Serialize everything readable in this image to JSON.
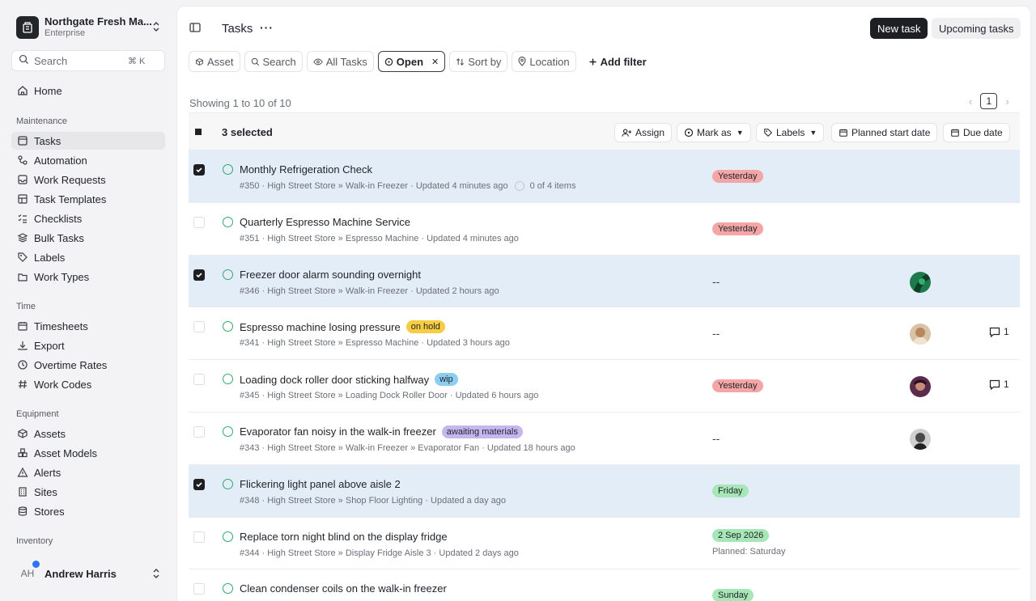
{
  "org": {
    "name": "Northgate Fresh Ma...",
    "plan": "Enterprise"
  },
  "search": {
    "placeholder": "Search",
    "shortcut": "⌘ K"
  },
  "nav": {
    "home": "Home",
    "sections": {
      "maintenance": "Maintenance",
      "time": "Time",
      "equipment": "Equipment",
      "inventory": "Inventory"
    },
    "maintenance": [
      "Tasks",
      "Automation",
      "Work Requests",
      "Task Templates",
      "Checklists",
      "Bulk Tasks",
      "Labels",
      "Work Types"
    ],
    "time": [
      "Timesheets",
      "Export",
      "Overtime Rates",
      "Work Codes"
    ],
    "equipment": [
      "Assets",
      "Asset Models",
      "Alerts",
      "Sites",
      "Stores"
    ]
  },
  "user": {
    "initials": "AH",
    "name": "Andrew Harris"
  },
  "header": {
    "title": "Tasks",
    "more": "···",
    "new_task": "New task",
    "upcoming": "Upcoming tasks"
  },
  "filters": {
    "asset": "Asset",
    "search": "Search",
    "all_tasks": "All Tasks",
    "open": "Open",
    "sort_by": "Sort by",
    "location": "Location",
    "add_filter": "Add filter"
  },
  "list": {
    "showing": "Showing 1 to 10 of 10",
    "page": "1"
  },
  "toolbar": {
    "selected": "3 selected",
    "assign": "Assign",
    "mark_as": "Mark as",
    "labels": "Labels",
    "planned_start": "Planned start date",
    "due_date": "Due date"
  },
  "colors": {
    "accent_dark": "#1d1f22",
    "selected_row": "#e3edf8",
    "status_open": "#2fa86a",
    "overdue": "#f4a6a6",
    "upcoming": "#a7e6b6"
  },
  "tasks": [
    {
      "checked": true,
      "title": "Monthly Refrigeration Check",
      "tag": "",
      "meta": "#350 · High Street Store » Walk-in Freezer · Updated 4 minutes ago",
      "items": "0 of 4 items",
      "date": "Yesterday",
      "planned": "",
      "comments": ""
    },
    {
      "checked": false,
      "title": "Quarterly Espresso Machine Service",
      "tag": "",
      "meta": "#351 · High Street Store » Espresso Machine · Updated 4 minutes ago",
      "items": "",
      "date": "Yesterday",
      "planned": "",
      "comments": ""
    },
    {
      "checked": true,
      "title": "Freezer door alarm sounding overnight",
      "tag": "",
      "meta": "#346 · High Street Store » Walk-in Freezer · Updated 2 hours ago",
      "items": "",
      "date": "--",
      "planned": "",
      "comments": ""
    },
    {
      "checked": false,
      "title": "Espresso machine losing pressure",
      "tag": "on hold",
      "meta": "#341 · High Street Store » Espresso Machine · Updated 3 hours ago",
      "items": "",
      "date": "--",
      "planned": "",
      "comments": "1"
    },
    {
      "checked": false,
      "title": "Loading dock roller door sticking halfway",
      "tag": "wip",
      "meta": "#345 · High Street Store » Loading Dock Roller Door · Updated 6 hours ago",
      "items": "",
      "date": "Yesterday",
      "planned": "",
      "comments": "1"
    },
    {
      "checked": false,
      "title": "Evaporator fan noisy in the walk-in freezer",
      "tag": "awaiting materials",
      "meta": "#343 · High Street Store » Walk-in Freezer » Evaporator Fan · Updated 18 hours ago",
      "items": "",
      "date": "--",
      "planned": "",
      "comments": ""
    },
    {
      "checked": true,
      "title": "Flickering light panel above aisle 2",
      "tag": "",
      "meta": "#348 · High Street Store » Shop Floor Lighting · Updated a day ago",
      "items": "",
      "date": "Friday",
      "planned": "",
      "comments": ""
    },
    {
      "checked": false,
      "title": "Replace torn night blind on the display fridge",
      "tag": "",
      "meta": "#344 · High Street Store » Display Fridge Aisle 3 · Updated 2 days ago",
      "items": "",
      "date": "2 Sep 2026",
      "planned": "Planned: Saturday",
      "comments": ""
    },
    {
      "checked": false,
      "title": "Clean condenser coils on the walk-in freezer",
      "tag": "",
      "meta": "",
      "items": "",
      "date": "Sunday",
      "planned": "",
      "comments": ""
    }
  ]
}
